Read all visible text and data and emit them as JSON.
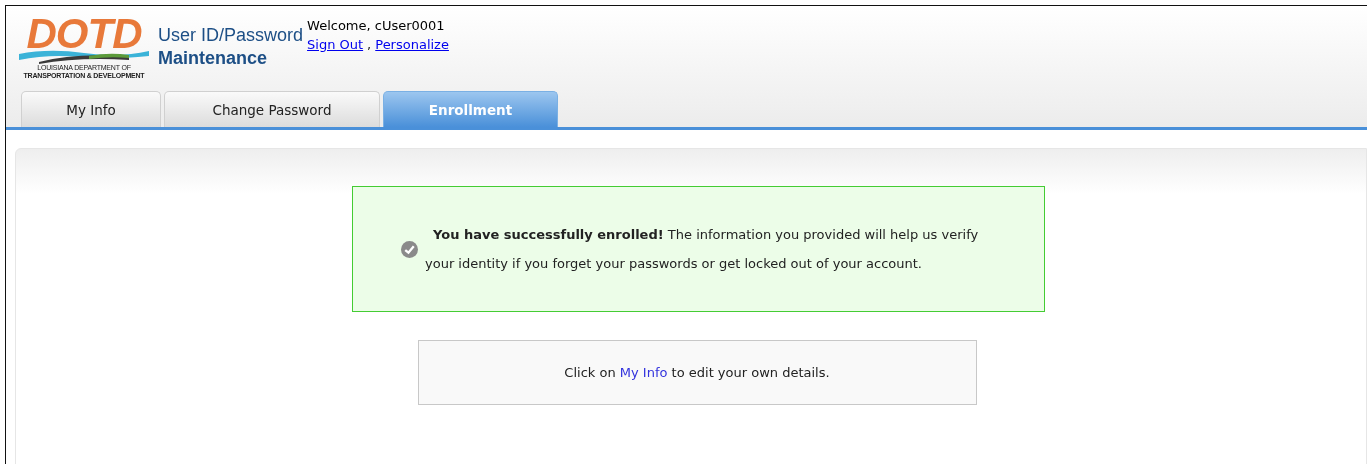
{
  "logo": {
    "mark": "DOTD",
    "line_1": "LOUISIANA DEPARTMENT OF",
    "line_2": "TRANSPORTATION & DEVELOPMENT"
  },
  "app_title": {
    "line_1": "User ID/Password",
    "line_2": "Maintenance"
  },
  "user": {
    "welcome": "Welcome, cUser0001",
    "links": [
      "Sign Out",
      "Personalize"
    ],
    "separator": ","
  },
  "tabs": [
    {
      "label": "My Info",
      "selected": false
    },
    {
      "label": "Change Password",
      "selected": false
    },
    {
      "label": "Enrollment",
      "selected": true
    }
  ],
  "success_message": {
    "text": "**You have successfully enrolled!** The information you provided will help us verify your identity if you forget your passwords or get locked out of your account."
  },
  "info_box": {
    "before": "Click on",
    "link": "My Info",
    "after": "to edit your own details."
  }
}
